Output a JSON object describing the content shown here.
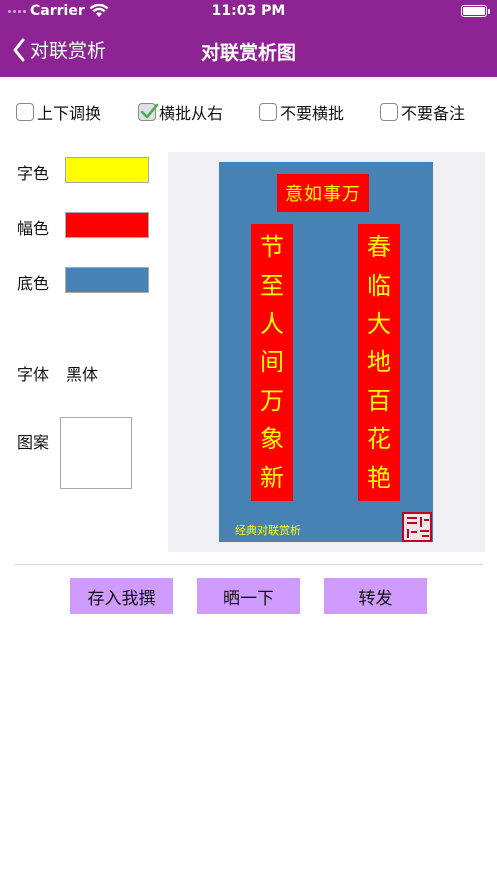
{
  "status": {
    "carrier": "Carrier",
    "time": "11:03 PM"
  },
  "nav": {
    "back_label": "对联赏析",
    "title": "对联赏析图"
  },
  "options": [
    {
      "label": "上下调换",
      "checked": false
    },
    {
      "label": "横批从右",
      "checked": true
    },
    {
      "label": "不要横批",
      "checked": false
    },
    {
      "label": "不要备注",
      "checked": false
    }
  ],
  "settings": {
    "text_color_label": "字色",
    "text_color": "#ffff00",
    "scroll_color_label": "幅色",
    "scroll_color": "#ff0000",
    "bg_color_label": "底色",
    "bg_color": "#4682b4",
    "font_label": "字体",
    "font_value": "黑体",
    "pattern_label": "图案"
  },
  "couplet": {
    "banner": "意如事万",
    "left_scroll": [
      "节",
      "至",
      "人",
      "间",
      "万",
      "象",
      "新"
    ],
    "right_scroll": [
      "春",
      "临",
      "大",
      "地",
      "百",
      "花",
      "艳"
    ],
    "caption": "经典对联赏析"
  },
  "actions": {
    "save": "存入我撰",
    "share": "晒一下",
    "forward": "转发"
  },
  "colors": {
    "header": "#8e2494",
    "button": "#cf9bff",
    "seal": "#c0001c"
  }
}
